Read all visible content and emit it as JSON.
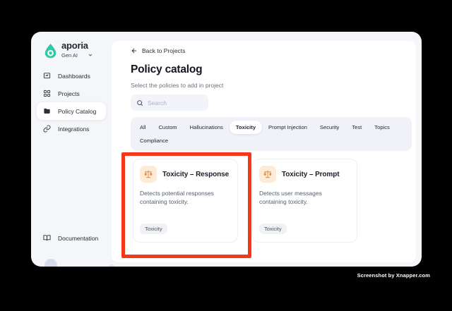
{
  "colors": {
    "accent_teal": "#2fc7a4",
    "annotation_red": "#f5381a",
    "policy_icon_orange": "#ee8a3a",
    "policy_icon_bg": "#fcebd7"
  },
  "sidebar": {
    "brand": "aporia",
    "workspace": "Gen AI",
    "items": [
      {
        "label": "Dashboards",
        "icon": "dashboard-icon",
        "active": false
      },
      {
        "label": "Projects",
        "icon": "grid-icon",
        "active": false
      },
      {
        "label": "Policy Catalog",
        "icon": "folder-icon",
        "active": true
      },
      {
        "label": "Integrations",
        "icon": "link-icon",
        "active": false
      }
    ],
    "footer": {
      "label": "Documentation",
      "icon": "book-icon"
    }
  },
  "main": {
    "back_link": "Back to Projects",
    "title": "Policy catalog",
    "subtitle": "Select the policies to add in project",
    "search": {
      "placeholder": "Search"
    },
    "tabs": [
      "All",
      "Custom",
      "Hallucinations",
      "Toxicity",
      "Prompt Injection",
      "Security",
      "Test",
      "Topics",
      "Compliance"
    ],
    "active_tab": "Toxicity",
    "cards": [
      {
        "title": "Toxicity – Response",
        "description": "Detects potential responses containing toxicity.",
        "tag": "Toxicity",
        "icon": "scales-icon",
        "highlighted": true
      },
      {
        "title": "Toxicity – Prompt",
        "description": "Detects user messages containing toxicity.",
        "tag": "Toxicity",
        "icon": "scales-icon",
        "highlighted": false
      }
    ]
  },
  "watermark": "Screenshot by Xnapper.com"
}
